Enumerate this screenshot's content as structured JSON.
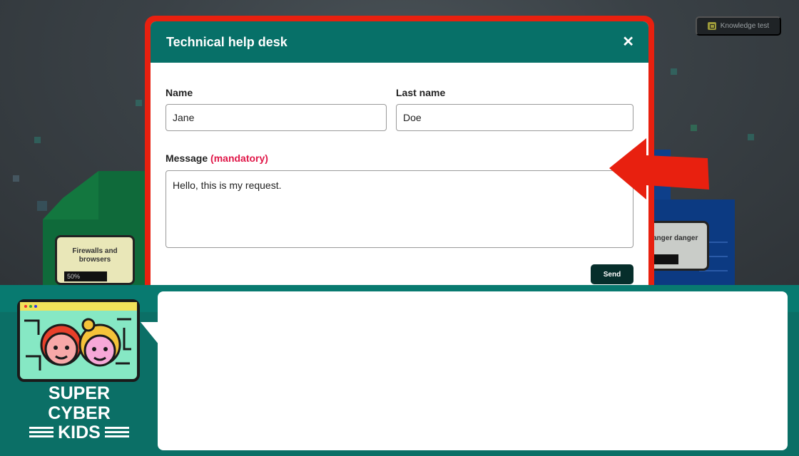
{
  "header_button": {
    "label": "Knowledge test",
    "icon": "book-icon"
  },
  "scene": {
    "cards": [
      {
        "title": "Firewalls and browsers",
        "progress": "50%",
        "progress_fraction": 0.5
      },
      {
        "title": "anger danger",
        "progress_fraction": 0.4
      }
    ]
  },
  "modal": {
    "title": "Technical help desk",
    "close_icon": "close-icon",
    "name_label": "Name",
    "name_value": "Jane",
    "lastname_label": "Last name",
    "lastname_value": "Doe",
    "message_label": "Message",
    "message_mandatory": "(mandatory)",
    "message_value": "Hello, this is my request.",
    "send_label": "Send"
  },
  "logo": {
    "line1": "SUPER CYBER",
    "line2": "KIDS"
  },
  "colors": {
    "header": "#077068",
    "highlight": "#e8200f",
    "mandatory": "#e01748",
    "send": "#062e2b",
    "band": "#0b6f66"
  }
}
